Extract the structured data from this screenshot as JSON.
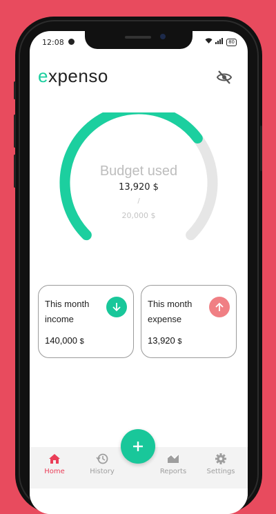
{
  "status": {
    "time": "12:08",
    "battery": "80"
  },
  "app": {
    "logo_first": "e",
    "logo_rest": "xpenso"
  },
  "budget": {
    "title": "Budget used",
    "used": "13,920 $",
    "slash": "/",
    "total": "20,000 $",
    "used_fraction": 0.696
  },
  "cards": {
    "income": {
      "label": "This month income",
      "amount": "140,000",
      "currency": "$",
      "icon": "arrow-down-icon",
      "color": "#19c79a"
    },
    "expense": {
      "label": "This month expense",
      "amount": "13,920",
      "currency": "$",
      "icon": "arrow-up-icon",
      "color": "#f07f84"
    }
  },
  "nav": {
    "items": [
      {
        "label": "Home",
        "icon": "home-icon"
      },
      {
        "label": "History",
        "icon": "history-icon"
      },
      {
        "label": "Reports",
        "icon": "reports-icon"
      },
      {
        "label": "Settings",
        "icon": "gear-icon"
      }
    ],
    "active": "Home"
  },
  "colors": {
    "background": "#e84b5e",
    "accent": "#1ccf9f",
    "active_nav": "#ea3e58",
    "gauge_track": "#e6e6e6"
  }
}
